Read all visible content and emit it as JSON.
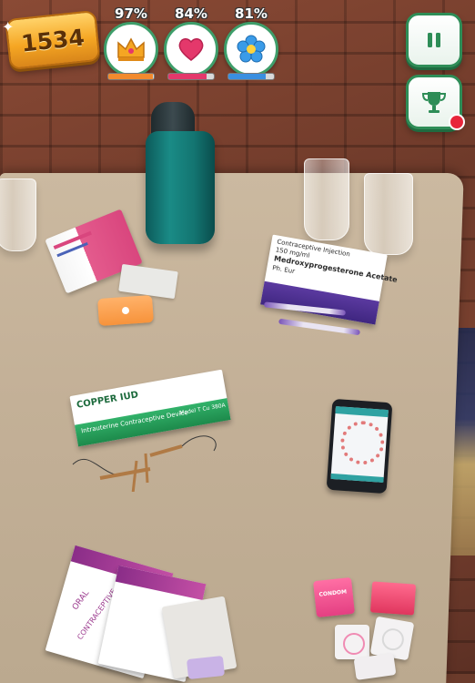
{
  "hud": {
    "score": "1534",
    "stats": [
      {
        "id": "crown",
        "percent_label": "97%",
        "level": 0.97,
        "bar_color": "#f28a2e",
        "icon": "crown-icon"
      },
      {
        "id": "heart",
        "percent_label": "84%",
        "level": 0.84,
        "bar_color": "#e4386b",
        "icon": "heart-icon"
      },
      {
        "id": "flower",
        "percent_label": "81%",
        "level": 0.81,
        "bar_color": "#3a8fe0",
        "icon": "flower-icon"
      }
    ],
    "pause_icon": "pause-icon",
    "trophy_icon": "trophy-icon",
    "accent_color": "#2e8d57"
  },
  "items": {
    "injection_box": {
      "line1": "Contraceptive Injection",
      "line2": "150 mg/ml",
      "line3": "Medroxyprogesterone Acetate",
      "line4": "Ph. Eur"
    },
    "iud_box": {
      "title": "COPPER IUD",
      "subtitle": "Intrauterine Contraceptive Device",
      "model": "Model T Cu 380A"
    },
    "oral_box": {
      "label1": "ORAL",
      "label2": "CONTRACEPTIVE"
    },
    "condom_box": {
      "label": "CONDOM"
    }
  }
}
